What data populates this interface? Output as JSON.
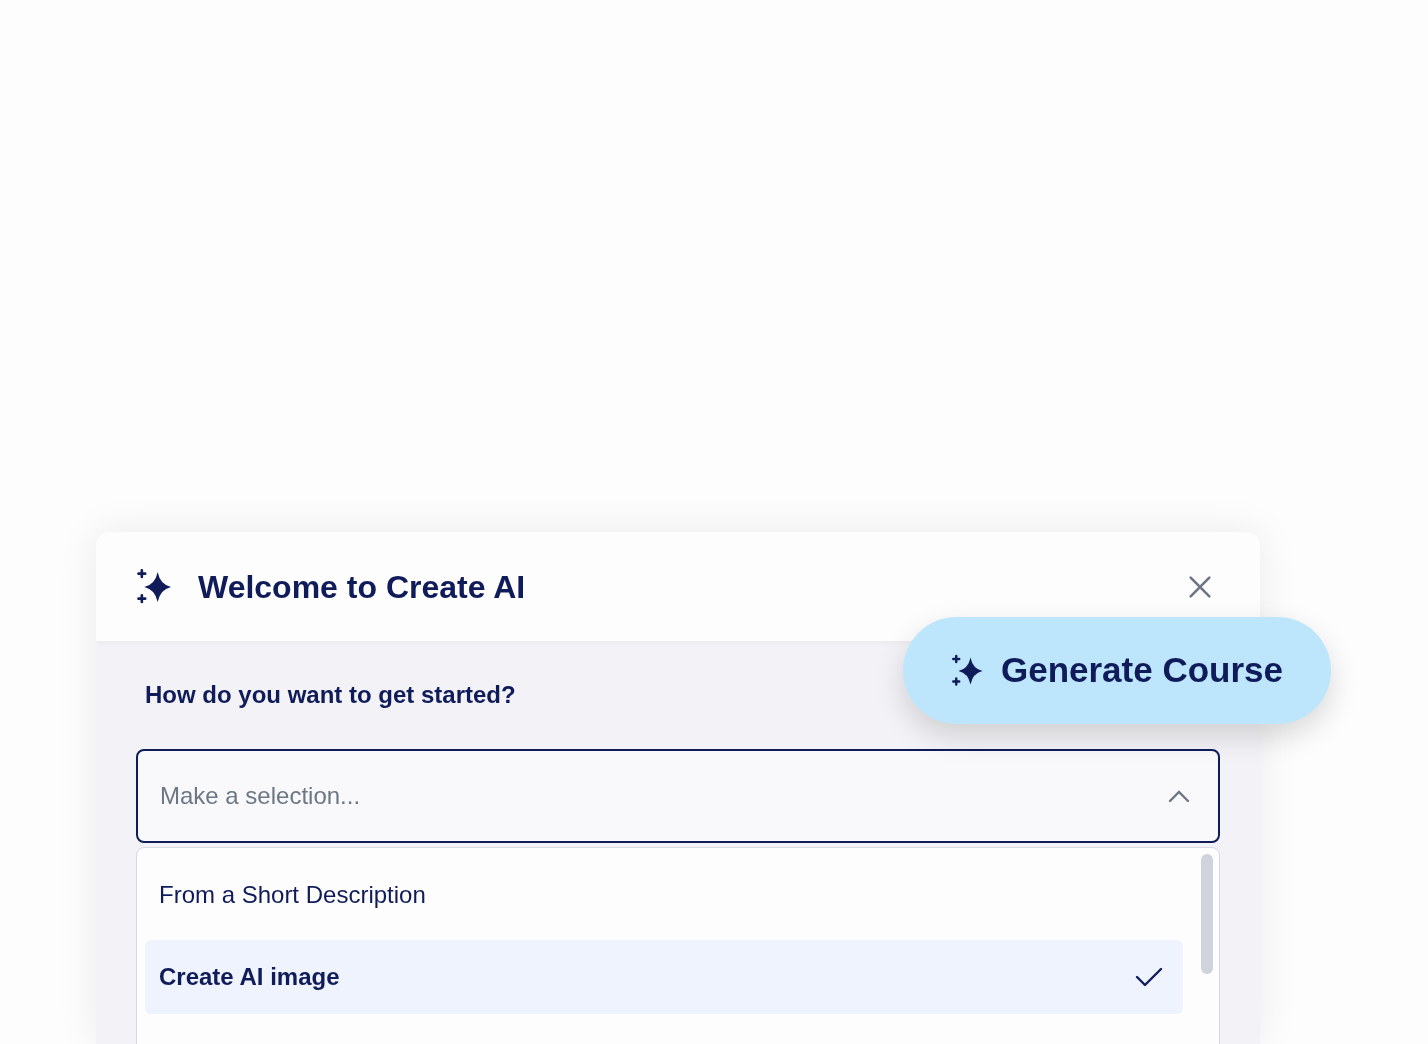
{
  "dialog": {
    "title": "Welcome to Create AI"
  },
  "generate_button": {
    "label": "Generate Course"
  },
  "question": "How do you want to get started?",
  "select": {
    "placeholder": "Make a selection...",
    "expanded": true
  },
  "options": [
    {
      "label": "From a Short Description",
      "selected": false
    },
    {
      "label": "Create AI image",
      "selected": true
    }
  ]
}
